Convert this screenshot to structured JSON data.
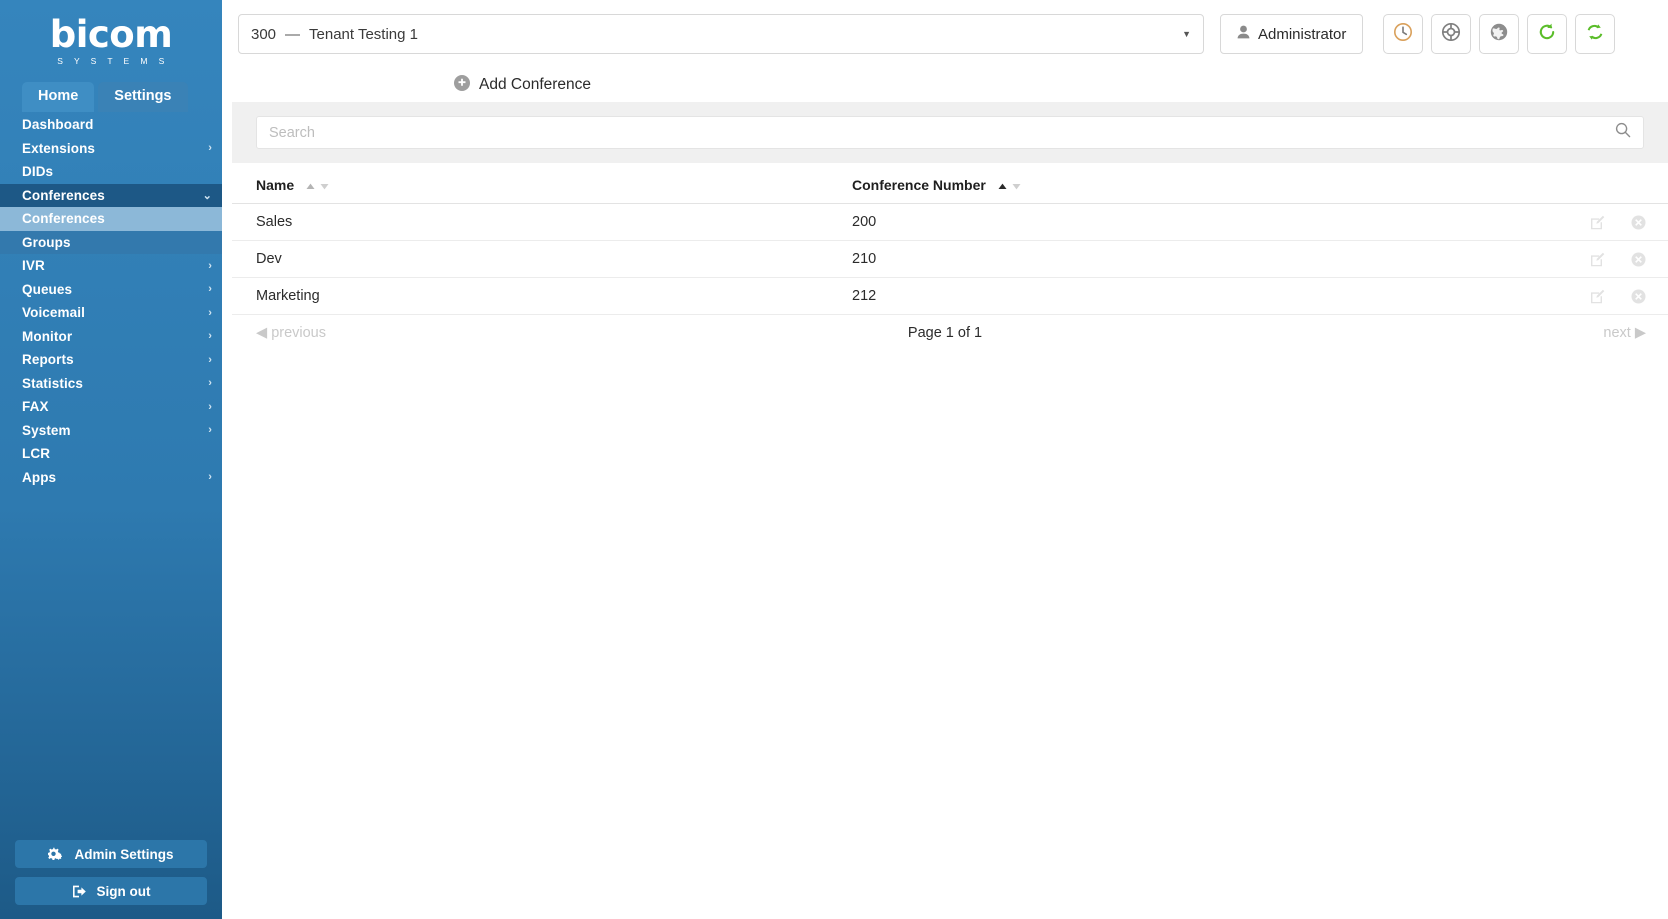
{
  "brand": {
    "name": "bicom",
    "tagline": "S Y S T E M S",
    "sidebar_color": "#2e7ab0",
    "accent_green": "#5bbd2a",
    "selected_color": "#8cb8d8"
  },
  "sidebar": {
    "tabs": [
      {
        "label": "Home",
        "active": true
      },
      {
        "label": "Settings",
        "active": false
      }
    ],
    "items": [
      {
        "label": "Dashboard",
        "chevron": "",
        "state": "normal"
      },
      {
        "label": "Extensions",
        "chevron": "›",
        "state": "normal"
      },
      {
        "label": "DIDs",
        "chevron": "",
        "state": "normal"
      },
      {
        "label": "Conferences",
        "chevron": "⌄",
        "state": "open"
      },
      {
        "label": "Conferences",
        "chevron": "",
        "state": "selected"
      },
      {
        "label": "Groups",
        "chevron": "",
        "state": "sub"
      },
      {
        "label": "IVR",
        "chevron": "›",
        "state": "normal"
      },
      {
        "label": "Queues",
        "chevron": "›",
        "state": "normal"
      },
      {
        "label": "Voicemail",
        "chevron": "›",
        "state": "normal"
      },
      {
        "label": "Monitor",
        "chevron": "›",
        "state": "normal"
      },
      {
        "label": "Reports",
        "chevron": "›",
        "state": "normal"
      },
      {
        "label": "Statistics",
        "chevron": "›",
        "state": "normal"
      },
      {
        "label": "FAX",
        "chevron": "›",
        "state": "normal"
      },
      {
        "label": "System",
        "chevron": "›",
        "state": "normal"
      },
      {
        "label": "LCR",
        "chevron": "",
        "state": "normal"
      },
      {
        "label": "Apps",
        "chevron": "›",
        "state": "normal"
      }
    ],
    "admin_settings_label": "Admin Settings",
    "sign_out_label": "Sign out"
  },
  "topbar": {
    "tenant_number": "300",
    "tenant_dash": "—",
    "tenant_name": "Tenant Testing 1",
    "admin_label": "Administrator",
    "icons": [
      {
        "name": "clock-icon"
      },
      {
        "name": "lifebuoy-icon"
      },
      {
        "name": "globe-icon"
      },
      {
        "name": "reload-icon"
      },
      {
        "name": "sync-icon"
      }
    ]
  },
  "actions": {
    "add_conference_label": "Add Conference"
  },
  "search": {
    "placeholder": "Search",
    "value": ""
  },
  "table": {
    "columns": [
      {
        "key": "name",
        "label": "Name",
        "sort": "none"
      },
      {
        "key": "number",
        "label": "Conference Number",
        "sort": "asc"
      }
    ],
    "rows": [
      {
        "name": "Sales",
        "number": "200"
      },
      {
        "name": "Dev",
        "number": "210"
      },
      {
        "name": "Marketing",
        "number": "212"
      }
    ]
  },
  "pagination": {
    "previous_label": "previous",
    "page_label": "Page 1 of 1",
    "next_label": "next"
  }
}
